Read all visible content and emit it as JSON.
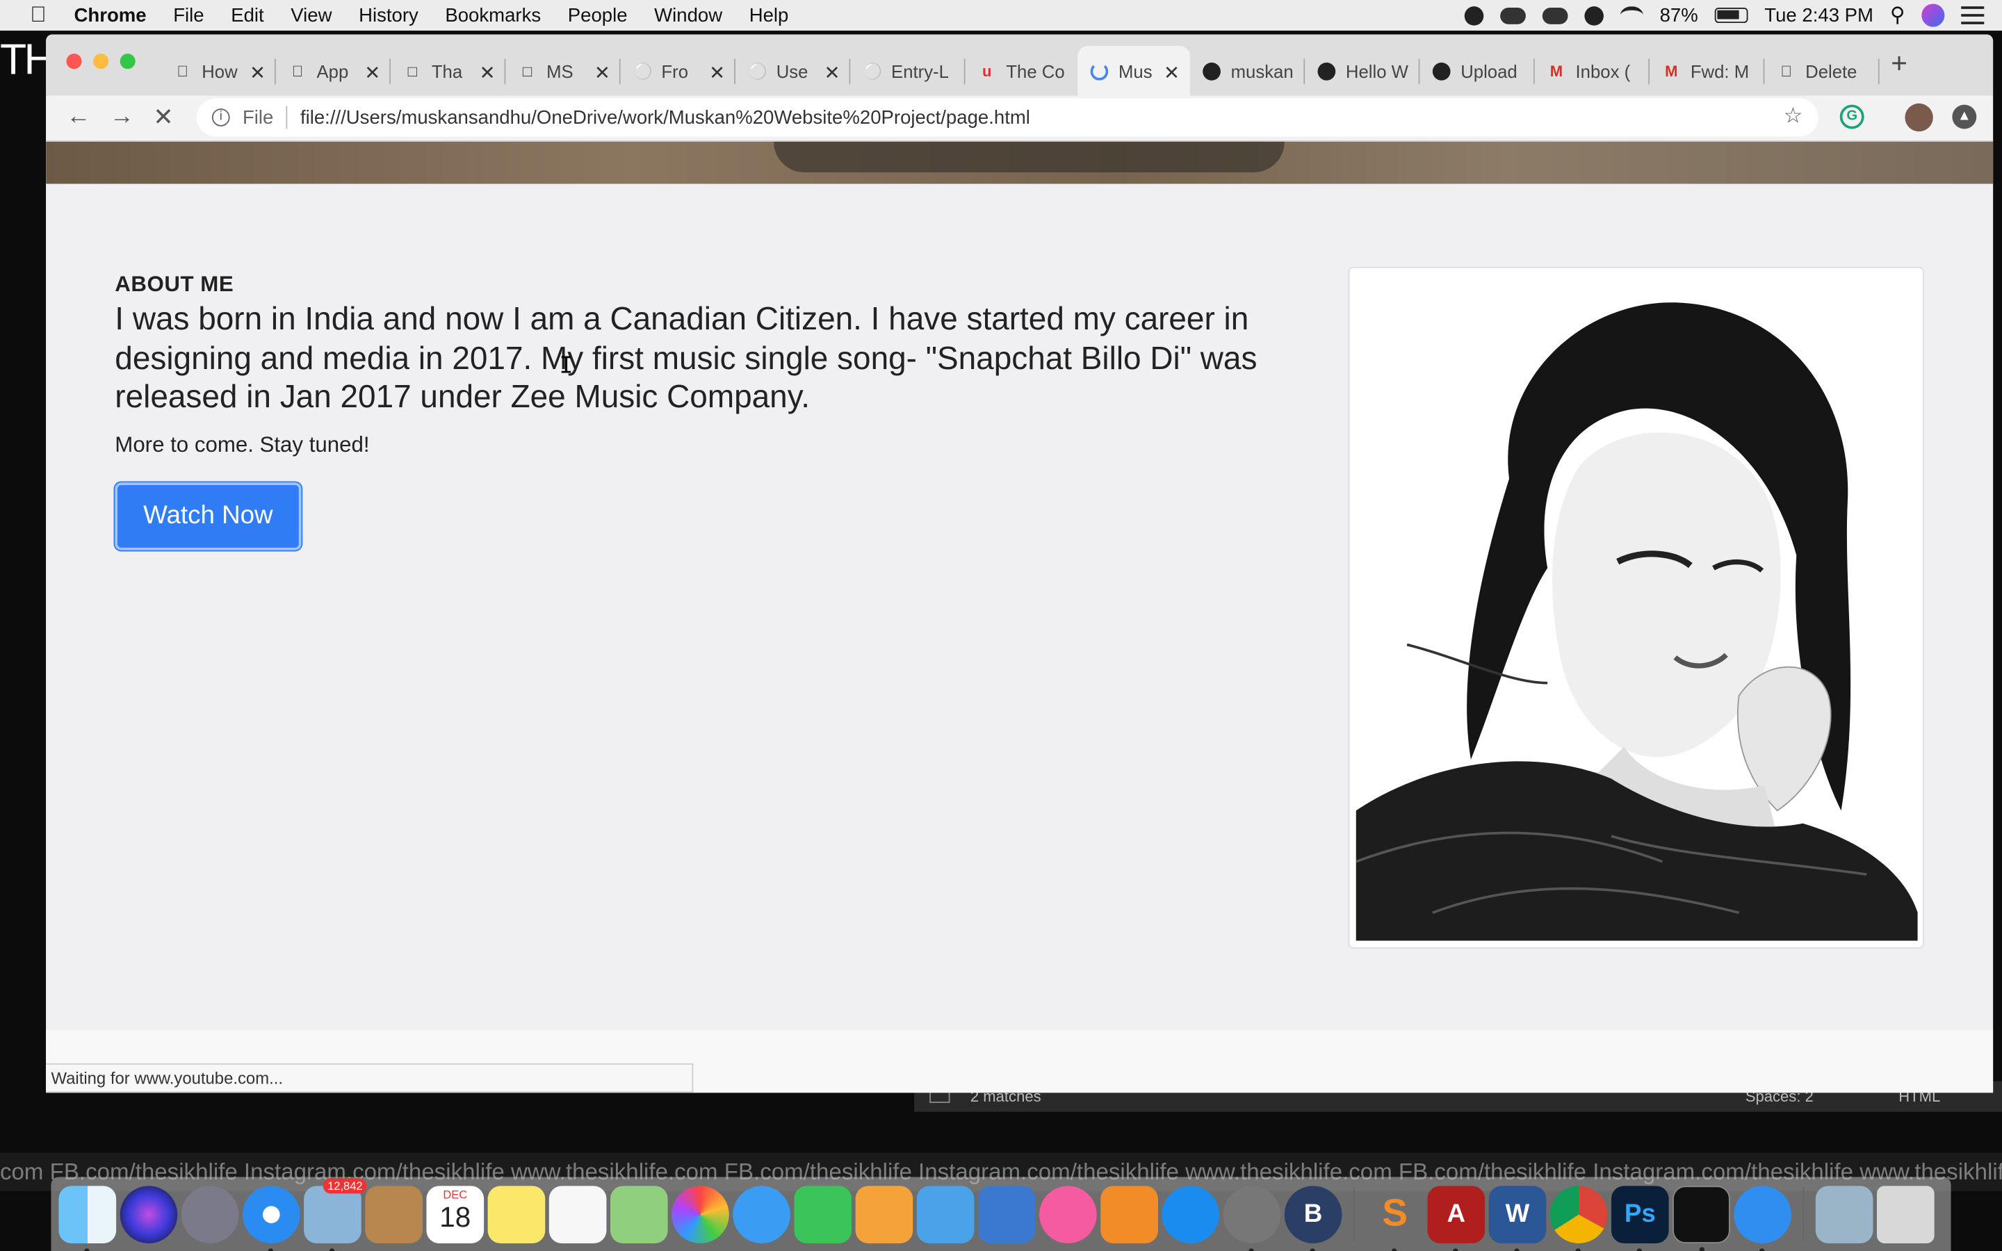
{
  "menubar": {
    "app": "Chrome",
    "items": [
      "File",
      "Edit",
      "View",
      "History",
      "Bookmarks",
      "People",
      "Window",
      "Help"
    ],
    "battery": "87%",
    "clock": "Tue 2:43 PM"
  },
  "background": {
    "partial_text": "TH",
    "editor_matches": "2 matches",
    "editor_spaces": "Spaces: 2",
    "editor_lang": "HTML",
    "ticker": "com    FB.com/thesikhlife    Instagram.com/thesikhlife    www.thesikhlife.com    FB.com/thesikhlife    Instagram.com/thesikhlife    www.thesikhlife.com    FB.com/thesikhlife    Instagram.com/thesikhlife    www.thesikhlife.com    FB.com/thesikhlife    Instagram.com/thesikhlife    www.thesikhlife.com"
  },
  "tabs": [
    {
      "title": "How",
      "icon": "apple-icon"
    },
    {
      "title": "App",
      "icon": "apple-icon"
    },
    {
      "title": "Tha",
      "icon": "page-icon"
    },
    {
      "title": "MS",
      "icon": "page-icon"
    },
    {
      "title": "Fro",
      "icon": "bike-icon"
    },
    {
      "title": "Use",
      "icon": "bike-icon"
    },
    {
      "title": "Entry-L",
      "icon": "bike-icon"
    },
    {
      "title": "The Co",
      "icon": "udemy-icon"
    },
    {
      "title": "Mus",
      "icon": "loading-spinner-icon",
      "active": true
    },
    {
      "title": "muskan",
      "icon": "github-icon"
    },
    {
      "title": "Hello W",
      "icon": "github-icon"
    },
    {
      "title": "Upload",
      "icon": "github-icon"
    },
    {
      "title": "Inbox (",
      "icon": "gmail-icon"
    },
    {
      "title": "Fwd: M",
      "icon": "gmail-icon"
    },
    {
      "title": "Delete",
      "icon": "apple-icon"
    }
  ],
  "toolbar": {
    "file_label": "File",
    "url": "file:///Users/muskansandhu/OneDrive/work/Muskan%20Website%20Project/page.html"
  },
  "page": {
    "section_label": "ABOUT ME",
    "lead": "I was born in India and now I am a Canadian Citizen. I have started my career in designing and media in 2017. My first music single song- \"Snapchat Billo Di\" was released in Jan 2017 under Zee Music Company.",
    "sub": "More to come. Stay tuned!",
    "button": "Watch Now",
    "status": "Waiting for www.youtube.com..."
  },
  "dock": {
    "mail_badge": "12,842",
    "calendar_month": "DEC",
    "calendar_day": "18"
  },
  "colors": {
    "accent_button": "#2f7cf5",
    "page_bg": "#f0f0f2",
    "ticker_bg": "#1b1b1b"
  }
}
